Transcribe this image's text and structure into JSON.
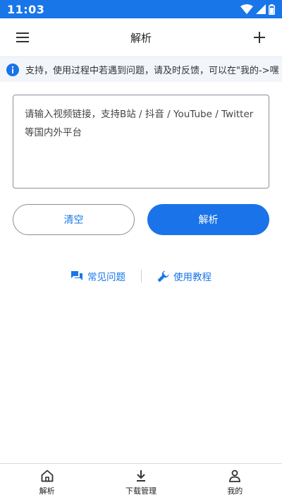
{
  "status_bar": {
    "time": "11:03"
  },
  "header": {
    "title": "解析"
  },
  "notice": {
    "text": "支持，使用过程中若遇到问题，请及时反馈，可以在\"我的->嘿"
  },
  "input": {
    "placeholder": "请输入视频链接，支持B站 / 抖音 / YouTube / Twitter等国内外平台",
    "value": ""
  },
  "actions": {
    "clear_label": "清空",
    "parse_label": "解析"
  },
  "links": {
    "faq_label": "常见问题",
    "tutorial_label": "使用教程"
  },
  "bottom_nav": [
    {
      "label": "解析",
      "icon": "home-icon"
    },
    {
      "label": "下载管理",
      "icon": "download-icon"
    },
    {
      "label": "我的",
      "icon": "profile-icon"
    }
  ],
  "colors": {
    "accent": "#1a73e8",
    "status_bar": "#1976e9"
  }
}
